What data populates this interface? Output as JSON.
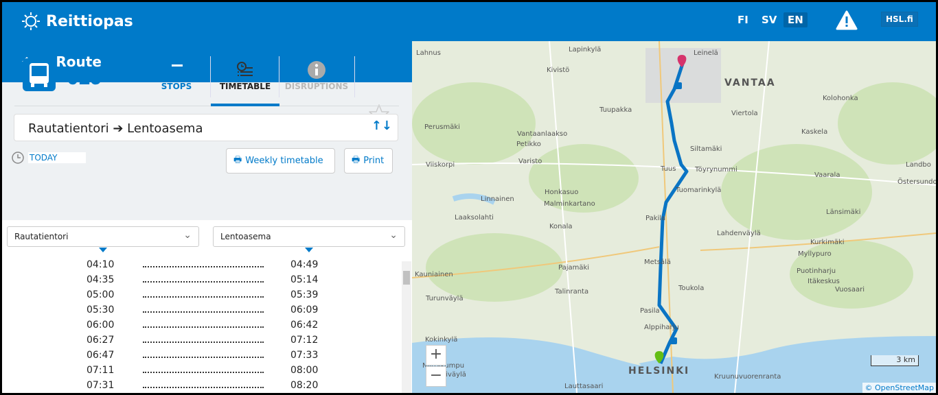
{
  "header": {
    "app_title": "Reittiopas",
    "languages": [
      "FI",
      "SV",
      "EN"
    ],
    "active_language": "EN",
    "hsl_link": "HSL.fi"
  },
  "route_bar": {
    "title": "Route"
  },
  "route": {
    "number": "615",
    "tabs": [
      {
        "label": "STOPS",
        "state": "normal"
      },
      {
        "label": "TIMETABLE",
        "state": "active"
      },
      {
        "label": "DISRUPTIONS",
        "state": "disabled"
      }
    ],
    "direction": "Rautatientori ➔ Lentoasema",
    "date": "TODAY",
    "weekly_timetable": "Weekly timetable",
    "print": "Print"
  },
  "timetable": {
    "from_stop": "Rautatientori",
    "to_stop": "Lentoasema",
    "rows": [
      {
        "dep": "04:10",
        "arr": "04:49"
      },
      {
        "dep": "04:35",
        "arr": "05:14"
      },
      {
        "dep": "05:00",
        "arr": "05:39"
      },
      {
        "dep": "05:30",
        "arr": "06:09"
      },
      {
        "dep": "06:00",
        "arr": "06:42"
      },
      {
        "dep": "06:27",
        "arr": "07:12"
      },
      {
        "dep": "06:47",
        "arr": "07:33"
      },
      {
        "dep": "07:11",
        "arr": "08:00"
      },
      {
        "dep": "07:31",
        "arr": "08:20"
      }
    ]
  },
  "map": {
    "labels": [
      "Lahnus",
      "Lapinkylä",
      "Leinelä",
      "Kivistö",
      "VANTAA",
      "Tuupakka",
      "Viertola",
      "Kolohonka",
      "Perusmäki",
      "Vantaanlaakso",
      "Kaskela",
      "Petikko",
      "Siltamäki",
      "Viiskorpi",
      "Varisto",
      "Tuus",
      "Töyrynummi",
      "Landbo",
      "Vaarala",
      "Östersundom",
      "Honkasuo",
      "Tuomarinkylä",
      "Linnainen",
      "Malminkartano",
      "Länsimäki",
      "Laaksolahti",
      "Pakila",
      "Konala",
      "Lahdenväylä",
      "Kurkimäki",
      "Myllypuro",
      "Pajamäki",
      "Metsälä",
      "Kauniainen",
      "Puotinharju",
      "Itäkeskus",
      "Turunväylä",
      "Talinranta",
      "Toukola",
      "Vuosaari",
      "Pasila",
      "Alppiharju",
      "Kokinkylä",
      "Niittykumpu",
      "HELSINKI",
      "Länsiväylä",
      "Lauttasaari",
      "Kruunuvuorenranta"
    ],
    "scale": "3 km",
    "attribution": "© OpenStreetMap",
    "route_color": "#0a74c4"
  },
  "colors": {
    "brand": "#007ac9",
    "destination_marker": "#d6336c",
    "origin_marker": "#64be14"
  }
}
